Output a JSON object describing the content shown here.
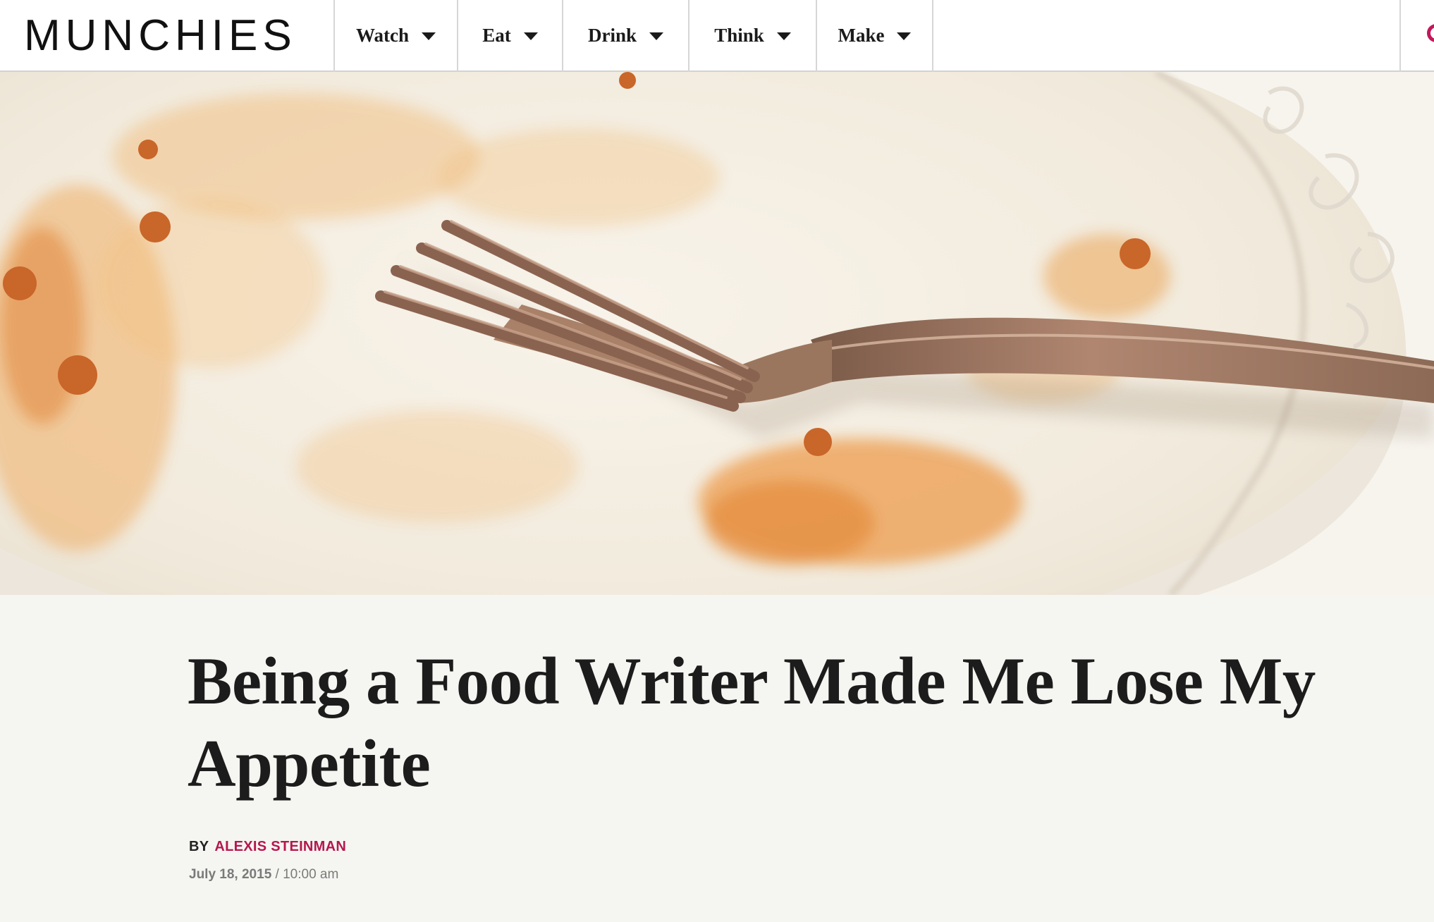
{
  "brand": {
    "logo_text": "MUNCHIES",
    "accent_color": "#b5174f"
  },
  "nav": {
    "items": [
      {
        "label": "Watch"
      },
      {
        "label": "Eat"
      },
      {
        "label": "Drink"
      },
      {
        "label": "Think"
      },
      {
        "label": "Make"
      }
    ],
    "search_icon": "search-icon"
  },
  "hero": {
    "image_description_icon": "hero-image"
  },
  "article": {
    "title": "Being a Food Writer Made Me Lose My Appetite",
    "byline_prefix": "BY",
    "author": "ALEXIS STEINMAN",
    "date": "July 18, 2015",
    "date_separator": "/",
    "time": "10:00 am"
  }
}
